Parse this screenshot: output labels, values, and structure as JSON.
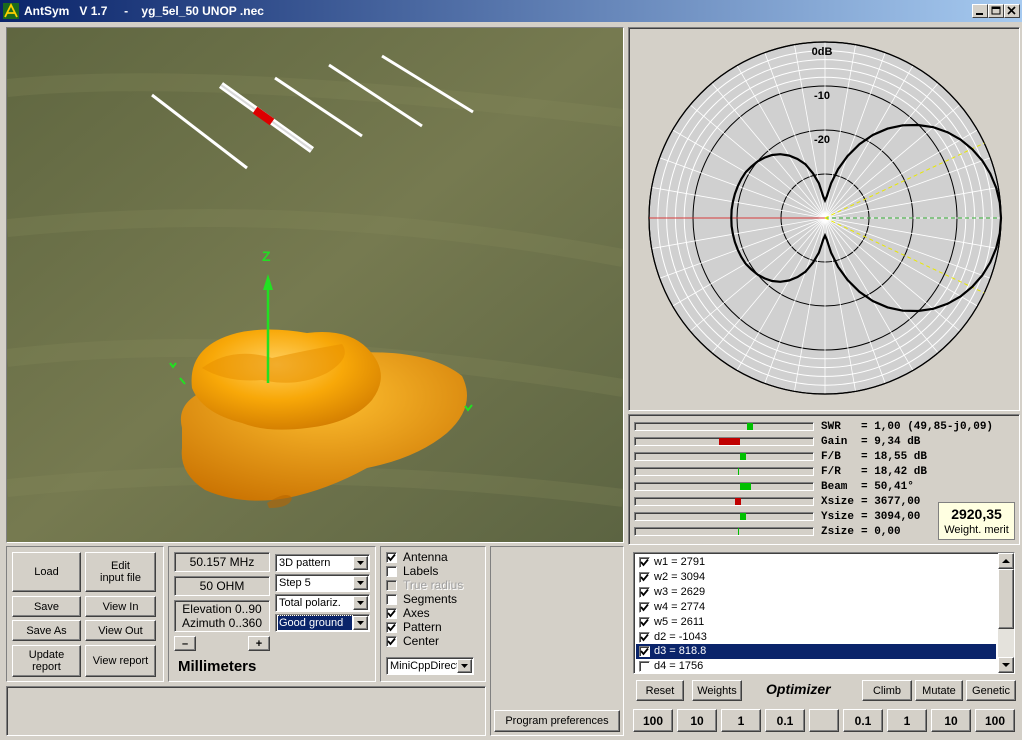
{
  "window": {
    "app_name": "AntSym",
    "version": "V 1.7",
    "separator": "-",
    "file": "yg_5el_50 UNOP .nec"
  },
  "polar": {
    "ring_labels": [
      "0dB",
      "-10",
      "-20"
    ],
    "pattern": [
      [
        0,
        0
      ],
      [
        5,
        -0.12
      ],
      [
        10,
        -0.48
      ],
      [
        15,
        -1.1
      ],
      [
        20,
        -1.95
      ],
      [
        25,
        -3.05
      ],
      [
        30,
        -4.4
      ],
      [
        35,
        -6.0
      ],
      [
        40,
        -7.9
      ],
      [
        45,
        -10.1
      ],
      [
        50,
        -12.5
      ],
      [
        55,
        -15.2
      ],
      [
        60,
        -18.2
      ],
      [
        65,
        -21.5
      ],
      [
        70,
        -25.0
      ],
      [
        75,
        -28.5
      ],
      [
        80,
        -32
      ],
      [
        85,
        -35
      ],
      [
        90,
        -36
      ],
      [
        95,
        -35
      ],
      [
        100,
        -32
      ],
      [
        105,
        -29.5
      ],
      [
        110,
        -27.0
      ],
      [
        115,
        -25.2
      ],
      [
        120,
        -23.6
      ],
      [
        125,
        -22.3
      ],
      [
        130,
        -21.3
      ],
      [
        135,
        -20.6
      ],
      [
        140,
        -20.0
      ],
      [
        145,
        -19.6
      ],
      [
        150,
        -19.2
      ],
      [
        155,
        -19.0
      ],
      [
        160,
        -18.9
      ],
      [
        165,
        -18.8
      ],
      [
        170,
        -18.75
      ],
      [
        175,
        -18.7
      ],
      [
        180,
        -18.7
      ],
      [
        185,
        -18.7
      ],
      [
        190,
        -18.75
      ],
      [
        195,
        -18.8
      ],
      [
        200,
        -18.9
      ],
      [
        205,
        -19.0
      ],
      [
        210,
        -19.2
      ],
      [
        215,
        -19.6
      ],
      [
        220,
        -20.0
      ],
      [
        225,
        -20.6
      ],
      [
        230,
        -21.3
      ],
      [
        235,
        -22.3
      ],
      [
        240,
        -23.6
      ],
      [
        245,
        -25.2
      ],
      [
        250,
        -27.0
      ],
      [
        255,
        -29.5
      ],
      [
        260,
        -32
      ],
      [
        265,
        -35
      ],
      [
        270,
        -36
      ],
      [
        275,
        -35
      ],
      [
        280,
        -32
      ],
      [
        285,
        -28.5
      ],
      [
        290,
        -25.0
      ],
      [
        295,
        -21.5
      ],
      [
        300,
        -18.2
      ],
      [
        305,
        -15.2
      ],
      [
        310,
        -12.5
      ],
      [
        315,
        -10.1
      ],
      [
        320,
        -7.9
      ],
      [
        325,
        -6.0
      ],
      [
        330,
        -4.4
      ],
      [
        335,
        -3.05
      ],
      [
        340,
        -1.95
      ],
      [
        345,
        -1.1
      ],
      [
        350,
        -0.48
      ],
      [
        355,
        -0.12
      ]
    ]
  },
  "metrics": [
    {
      "label": "SWR",
      "value": "= 1,00 (49,85-j0,09)",
      "bar": "green",
      "pos": 0.63
    },
    {
      "label": "Gain",
      "value": "= 9,34 dB",
      "bar": "red",
      "pos": 0.47,
      "pos_end": 0.59
    },
    {
      "label": "F/B",
      "value": "= 18,55 dB",
      "bar": "green",
      "pos": 0.59
    },
    {
      "label": "F/R",
      "value": "= 18,42 dB",
      "bar": "line",
      "pos": 0.58
    },
    {
      "label": "Beam",
      "value": "= 50,41°",
      "bar": "green",
      "pos": 0.59,
      "pos_end": 0.65
    },
    {
      "label": "Xsize",
      "value": "= 3677,00",
      "bar": "red",
      "pos": 0.56
    },
    {
      "label": "Ysize",
      "value": "= 3094,00",
      "bar": "green",
      "pos": 0.59
    },
    {
      "label": "Zsize",
      "value": "= 0,00",
      "bar": "line",
      "pos": 0.58
    }
  ],
  "merit": {
    "value": "2920,35",
    "label": "Weight. merit"
  },
  "buttons": {
    "load": "Load",
    "edit_input": "Edit\ninput file",
    "save": "Save",
    "view_in": "View In",
    "save_as": "Save As",
    "view_out": "View Out",
    "update_report": "Update\nreport",
    "view_report": "View report",
    "program_preferences": "Program preferences"
  },
  "params": {
    "frequency": "50.157 MHz",
    "impedance": "50 OHM",
    "elevation": "Elevation 0..90",
    "azimuth": "Azimuth 0..360",
    "minus": "–",
    "plus": "+",
    "units": "Millimeters"
  },
  "combos": {
    "pattern_type": "3D pattern",
    "step": "Step 5",
    "polarization": "Total polariz.",
    "ground": "Good ground",
    "engine": "MiniCppDirect"
  },
  "checkboxes": [
    {
      "label": "Antenna",
      "checked": true,
      "disabled": false
    },
    {
      "label": "Labels",
      "checked": false,
      "disabled": false
    },
    {
      "label": "True radius",
      "checked": false,
      "disabled": true
    },
    {
      "label": "Segments",
      "checked": false,
      "disabled": false
    },
    {
      "label": "Axes",
      "checked": true,
      "disabled": false
    },
    {
      "label": "Pattern",
      "checked": true,
      "disabled": false
    },
    {
      "label": "Center",
      "checked": true,
      "disabled": false
    }
  ],
  "optimizer_list": [
    {
      "label": "w1 = 2791",
      "checked": true,
      "selected": false
    },
    {
      "label": "w2 = 3094",
      "checked": true,
      "selected": false
    },
    {
      "label": "w3 = 2629",
      "checked": true,
      "selected": false
    },
    {
      "label": "w4 = 2774",
      "checked": true,
      "selected": false
    },
    {
      "label": "w5 = 2611",
      "checked": true,
      "selected": false
    },
    {
      "label": "d2 = -1043",
      "checked": true,
      "selected": false
    },
    {
      "label": "d3 = 818.8",
      "checked": true,
      "selected": true
    },
    {
      "label": "d4 = 1756",
      "checked": false,
      "selected": false
    }
  ],
  "optimizer": {
    "title": "Optimizer",
    "reset": "Reset",
    "weights": "Weights",
    "climb": "Climb",
    "mutate": "Mutate",
    "genetic": "Genetic",
    "steps": [
      "100",
      "10",
      "1",
      "0.1",
      "",
      "0.1",
      "1",
      "10",
      "100"
    ]
  },
  "view3d": {
    "axis_label": "Z"
  },
  "colors": {
    "title_start": "#0a246a",
    "title_end": "#a6caf0",
    "selection": "#0a246a",
    "ground": "#6b7048",
    "pattern_orange": "#f4a000",
    "axis_green": "#22e022",
    "meter_green": "#00c000",
    "meter_red": "#c00000"
  }
}
